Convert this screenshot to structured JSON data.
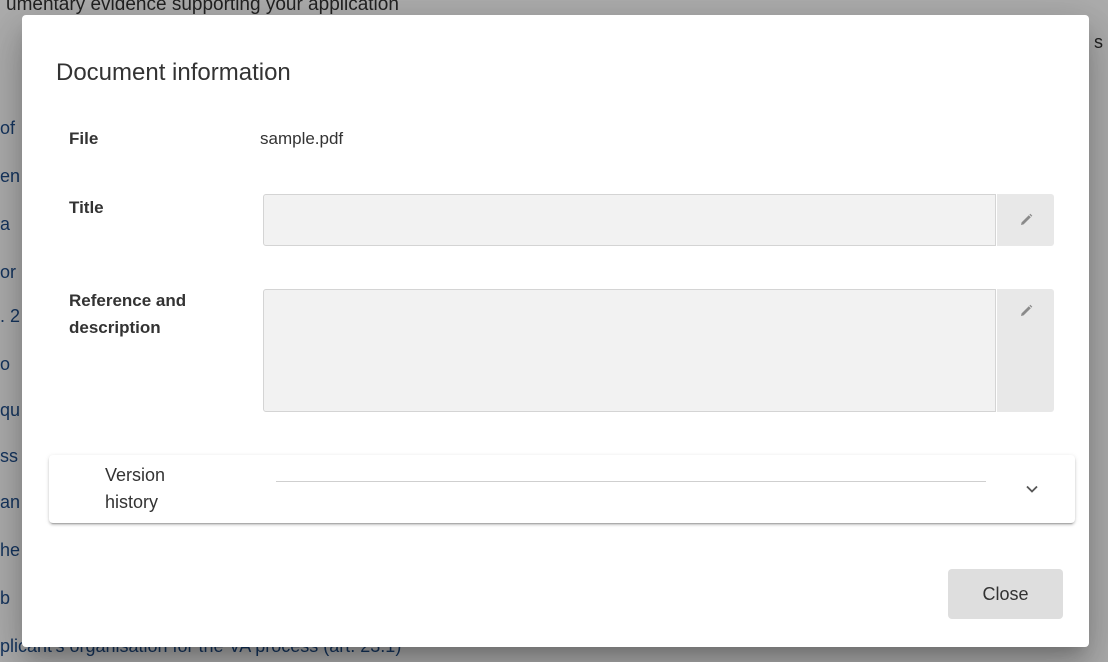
{
  "background": {
    "heading": "umentary evidence supporting your application",
    "fragments": [
      "of",
      "en",
      "a",
      "or",
      ". 2",
      "o",
      "qu",
      "ss",
      "an",
      "he",
      "b"
    ],
    "bottom_text": "plicant's organisation for the VA process (art. 23.1)",
    "right_fragment": "s"
  },
  "dialog": {
    "title": "Document information",
    "fields": {
      "file_label": "File",
      "file_value": "sample.pdf",
      "title_label": "Title",
      "title_value": "",
      "reference_label": "Reference and description",
      "reference_value": ""
    },
    "icons": {
      "edit": "pencil-icon",
      "expand": "chevron-down-icon"
    },
    "version_history": {
      "label": "Version history",
      "expanded": false
    },
    "close_label": "Close"
  }
}
